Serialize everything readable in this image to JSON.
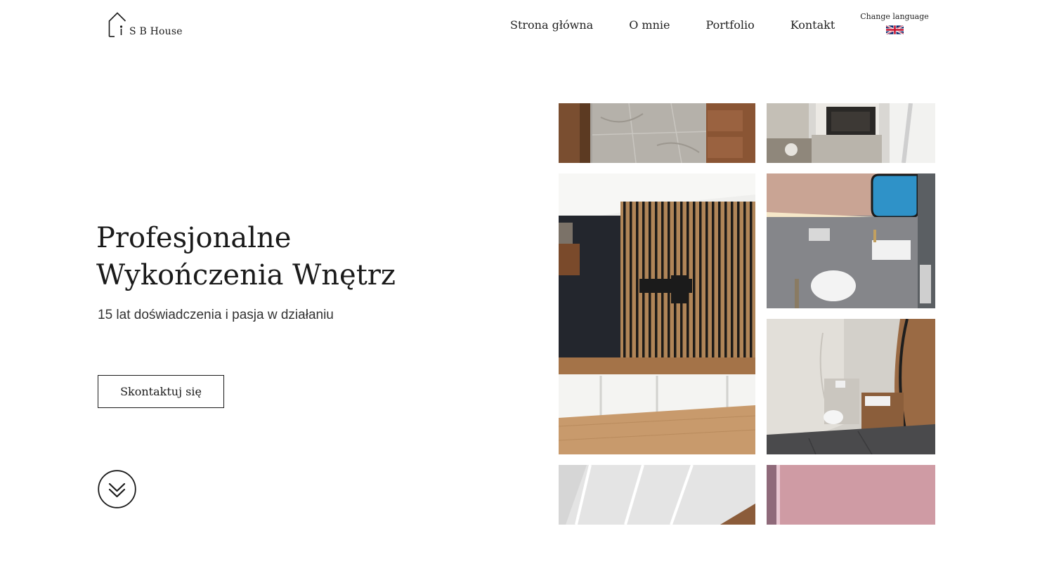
{
  "header": {
    "logo_text": "S B House",
    "nav": [
      {
        "label": "Strona główna"
      },
      {
        "label": "O mnie"
      },
      {
        "label": "Portfolio"
      },
      {
        "label": "Kontakt"
      }
    ],
    "language": {
      "label": "Change language",
      "flag_icon": "uk-flag-icon"
    }
  },
  "hero": {
    "title_line1": "Profesjonalne",
    "title_line2": "Wykończenia Wnętrz",
    "subtitle": "15 lat doświadczenia i pasja w działaniu",
    "cta_label": "Skontaktuj się",
    "scroll_icon": "double-chevron-down-icon"
  },
  "gallery": {
    "photos": [
      "hallway-floor-photo",
      "fireplace-photo",
      "slat-wall-tv-photo",
      "bathroom-backlit-mirror-photo",
      "bathroom-wood-vanity-photo",
      "led-ceiling-photo",
      "pink-ceiling-photo"
    ]
  },
  "colors": {
    "text": "#1a1a1a",
    "background": "#ffffff"
  }
}
